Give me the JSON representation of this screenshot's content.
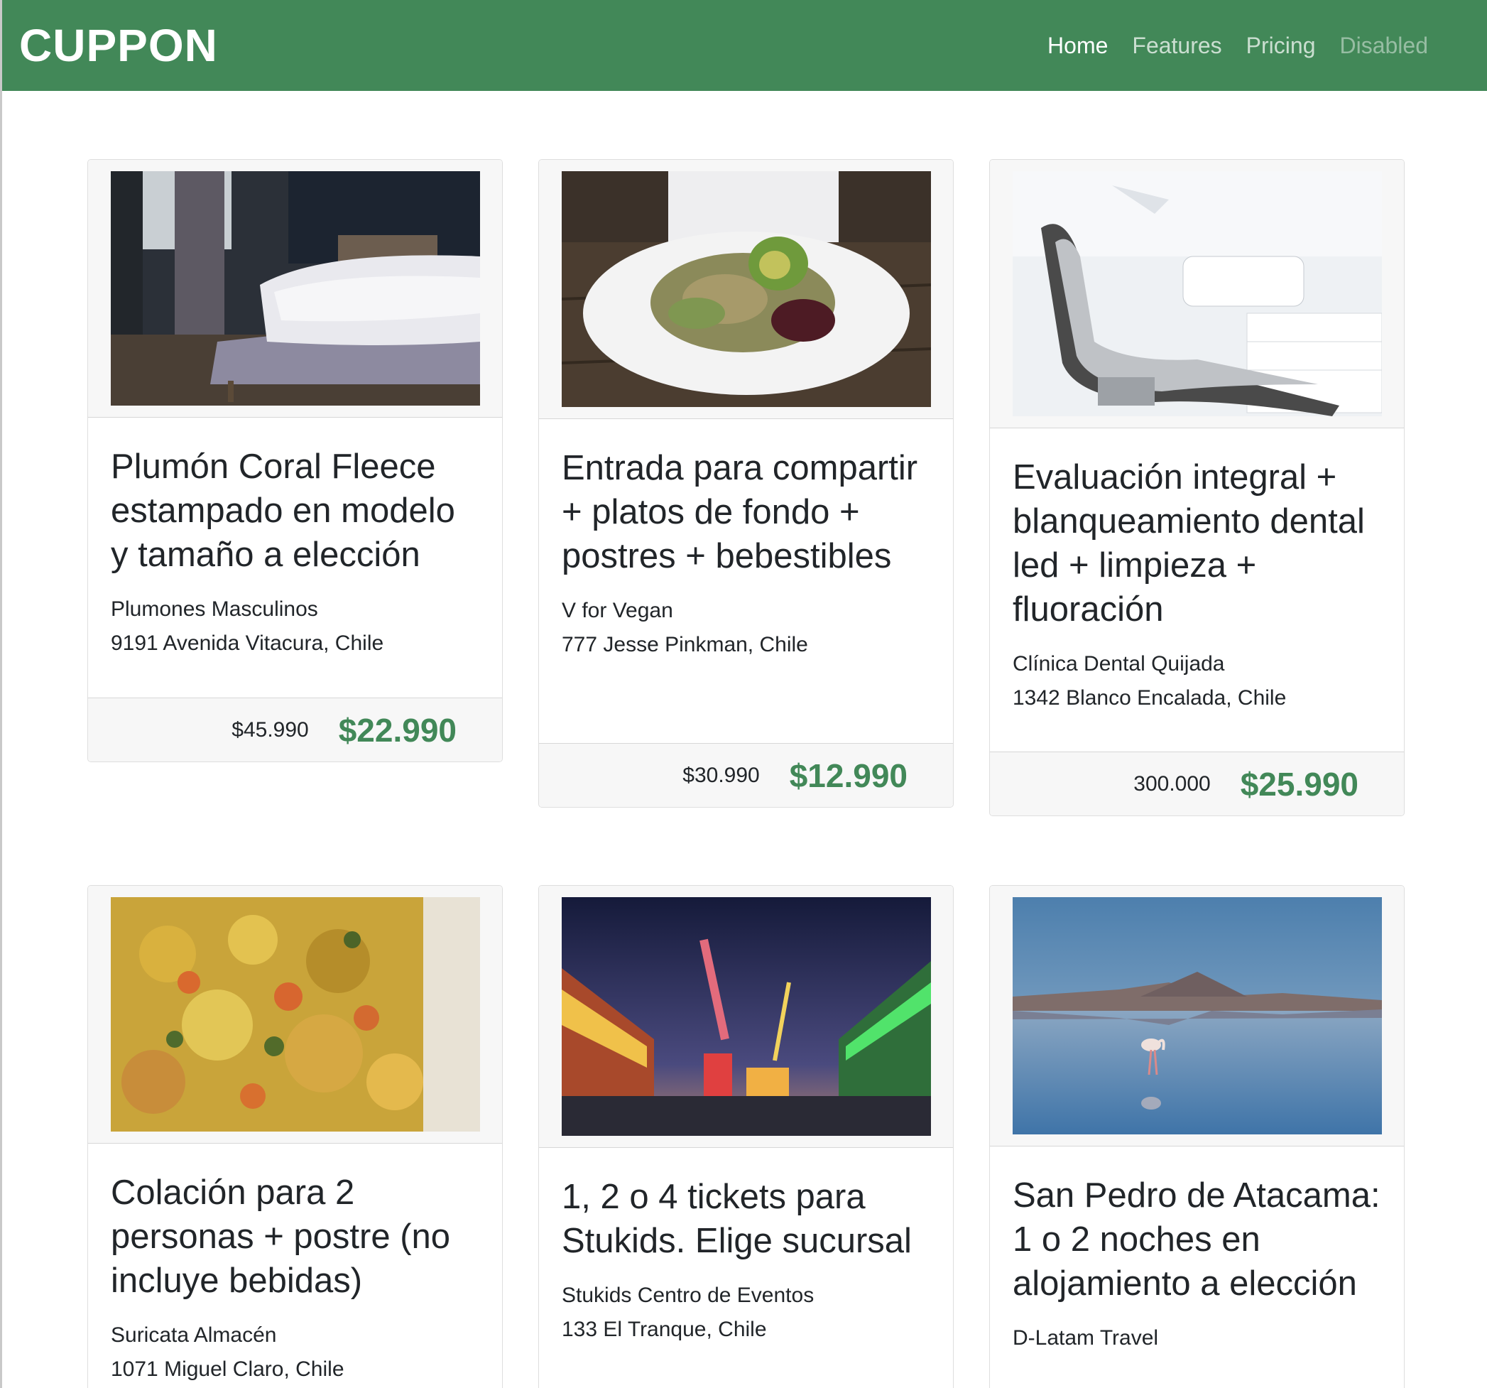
{
  "brand": "CUPPON",
  "nav": [
    "Home",
    "Features",
    "Pricing",
    "Disabled"
  ],
  "cards": [
    {
      "image": "bedroom-photo",
      "title": "Plumón Coral Fleece estampado en modelo y tamaño a elección",
      "vendor": "Plumones Masculinos",
      "address": "9191 Avenida Vitacura, Chile",
      "old_price": "$45.990",
      "new_price": "$22.990"
    },
    {
      "image": "vegan-salad-photo",
      "title": "Entrada para compartir + platos de fondo + postres + bebestibles",
      "vendor": "V for Vegan",
      "address": "777 Jesse Pinkman, Chile",
      "old_price": "$30.990",
      "new_price": "$12.990"
    },
    {
      "image": "dental-chair-photo",
      "title": "Evaluación integral + blanqueamiento dental led + limpieza + fluoración",
      "vendor": "Clínica Dental Quijada",
      "address": "1342 Blanco Encalada, Chile",
      "old_price": "300.000",
      "new_price": "$25.990"
    },
    {
      "image": "food-bowl-photo",
      "title": "Colación para 2 personas + postre (no incluye bebidas)",
      "vendor": "Suricata Almacén",
      "address": "1071 Miguel Claro, Chile"
    },
    {
      "image": "fair-night-photo",
      "title": "1, 2 o 4 tickets para Stukids. Elige sucursal",
      "vendor": "Stukids Centro de Eventos",
      "address": "133 El Tranque, Chile"
    },
    {
      "image": "flamingo-lake-photo",
      "title": "San Pedro de Atacama: 1 o 2 noches en alojamiento a elección",
      "vendor": "D-Latam Travel"
    }
  ]
}
